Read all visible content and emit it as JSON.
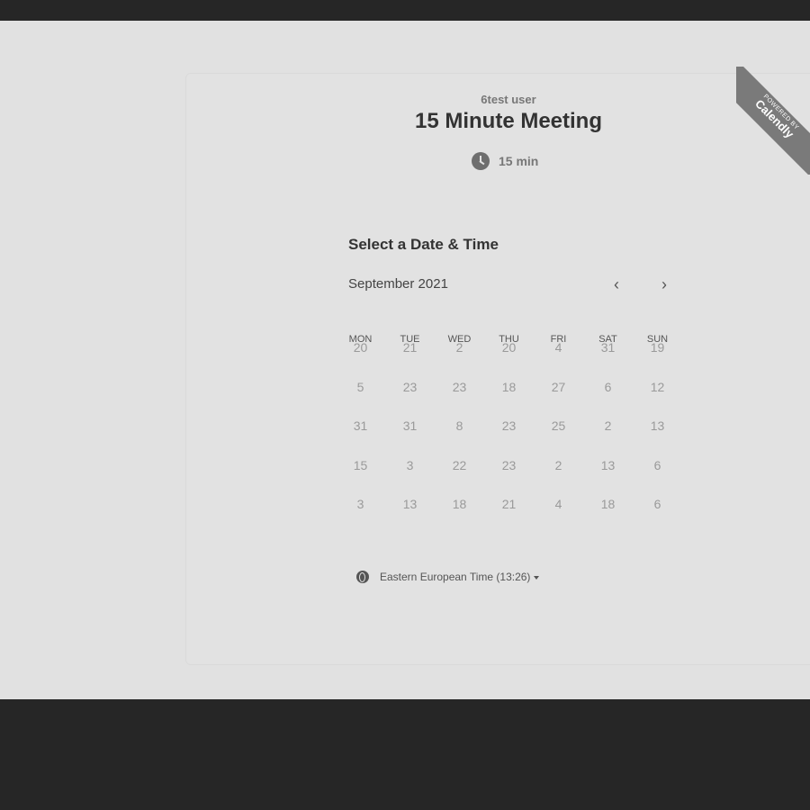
{
  "event": {
    "owner": "6test user",
    "title": "15 Minute Meeting",
    "duration": "15 min",
    "duration_icon": "clock-icon"
  },
  "badge": {
    "small_text": "POWERED BY",
    "brand_text": "Calendly"
  },
  "calendar": {
    "section_title": "Select a Date & Time",
    "month_label": "September 2021",
    "prev_label": "‹",
    "next_label": "›",
    "weekdays": [
      "MON",
      "TUE",
      "WED",
      "THU",
      "FRI",
      "SAT",
      "SUN"
    ],
    "weeks": [
      [
        "20",
        "21",
        "2",
        "20",
        "4",
        "31",
        "19"
      ],
      [
        "5",
        "23",
        "23",
        "18",
        "27",
        "6",
        "12"
      ],
      [
        "31",
        "31",
        "8",
        "23",
        "25",
        "2",
        "13"
      ],
      [
        "15",
        "3",
        "22",
        "23",
        "2",
        "13",
        "6"
      ],
      [
        "3",
        "13",
        "18",
        "21",
        "4",
        "18",
        "6"
      ]
    ]
  },
  "timezone": {
    "label": "Eastern European Time (13:26)",
    "icon": "globe-icon"
  },
  "colors": {
    "page_background": "#262626",
    "card_background": "#e2e2e2",
    "badge_background": "#7a7a7a"
  }
}
